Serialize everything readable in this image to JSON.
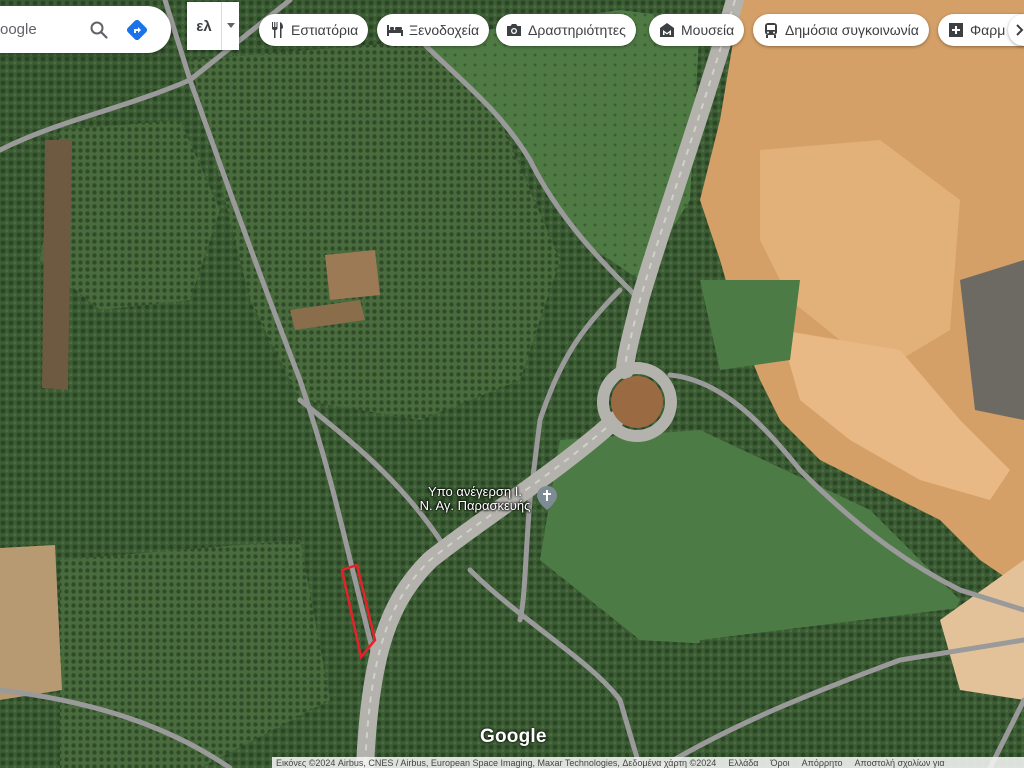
{
  "search": {
    "query": "oogle"
  },
  "language": {
    "label": "ελ"
  },
  "chips": [
    {
      "label": "Εστιατόρια",
      "icon": "fork-knife-icon"
    },
    {
      "label": "Ξενοδοχεία",
      "icon": "bed-icon"
    },
    {
      "label": "Δραστηριότητες",
      "icon": "camera-icon"
    },
    {
      "label": "Μουσεία",
      "icon": "museum-icon"
    },
    {
      "label": "Δημόσια συγκοινωνία",
      "icon": "bus-icon"
    },
    {
      "label": "Φαρμ",
      "icon": "pharmacy-icon"
    }
  ],
  "place": {
    "line1": "Υπο ανέγερση Ι.",
    "line2": "Ν. Αγ. Παρασκευής",
    "icon": "church-icon"
  },
  "logo": "Google",
  "attribution": {
    "credits": "Εικόνες ©2024 Airbus, CNES / Airbus, European Space Imaging, Maxar Technologies, Δεδομένα χάρτη ©2024",
    "links": [
      "Ελλάδα",
      "Όροι",
      "Απόρρητο",
      "Αποστολή σχολίων για"
    ]
  },
  "colors": {
    "parcel_outline": "#e8202a",
    "road": "#a8a8a8",
    "chip_bg": "#ffffff",
    "directions": "#1a73e8"
  }
}
